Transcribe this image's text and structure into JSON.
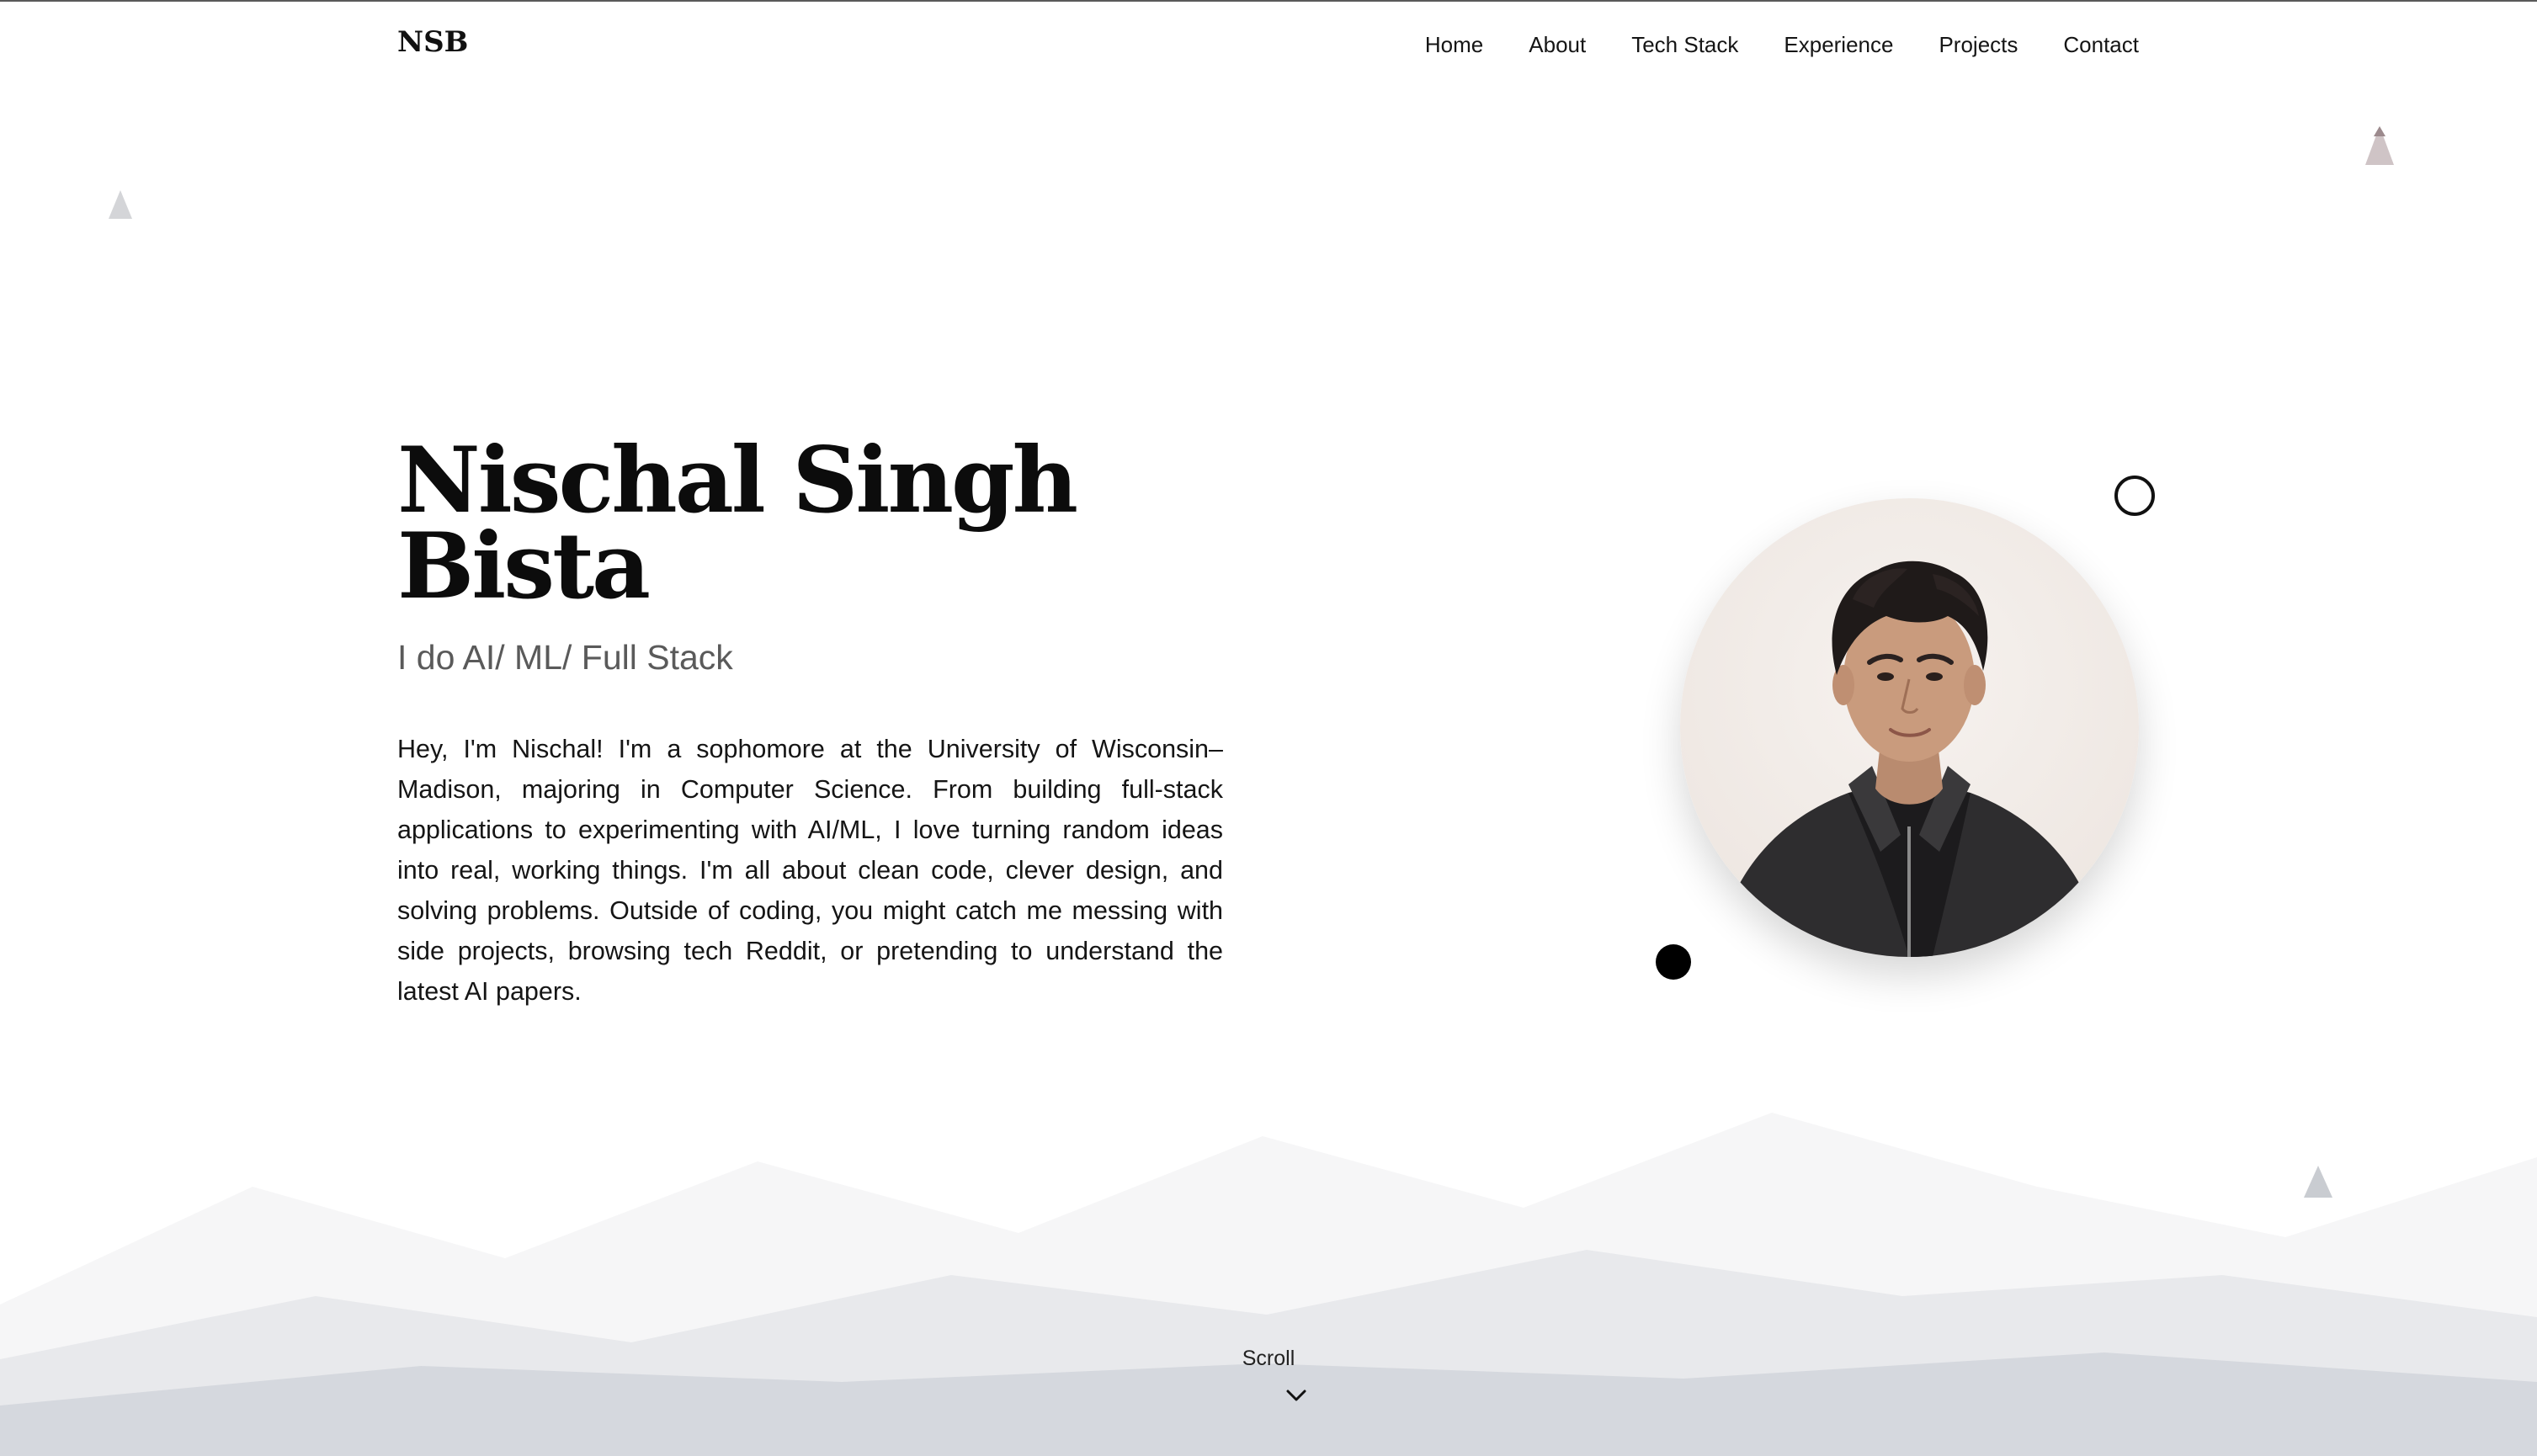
{
  "nav": {
    "logo": "NSB",
    "items": [
      {
        "label": "Home"
      },
      {
        "label": "About"
      },
      {
        "label": "Tech Stack"
      },
      {
        "label": "Experience"
      },
      {
        "label": "Projects"
      },
      {
        "label": "Contact"
      }
    ]
  },
  "hero": {
    "name_line1": "Nischal Singh",
    "name_line2": "Bista",
    "subtitle": "I do AI/ ML/ Full Stack",
    "bio": "Hey, I'm Nischal! I'm a sophomore at the University of Wisconsin–Madison, majoring in Computer Science. From building full-stack applications to experimenting with AI/ML, I love turning random ideas into real, working things. I'm all about clean code, clever design, and solving problems. Outside of coding, you might catch me messing with side projects, browsing tech Reddit, or pretending to understand the latest AI papers."
  },
  "portrait": {
    "icon": "profile-photo"
  },
  "scroll": {
    "label": "Scroll",
    "icon": "chevron-down-icon"
  },
  "colors": {
    "text": "#111111",
    "subtitle": "#5a5a5a",
    "mountain_far": "#f6f6f7",
    "mountain_mid": "#e8e9ec",
    "mountain_near": "#d5d8de"
  }
}
